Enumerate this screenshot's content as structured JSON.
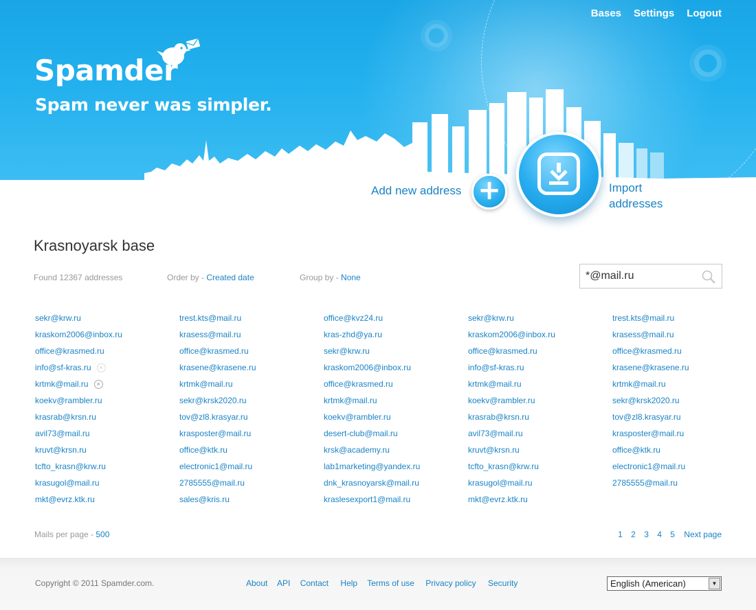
{
  "header": {
    "logo": "Spamder",
    "tagline": "Spam never was simpler.",
    "nav": [
      "Bases",
      "Settings",
      "Logout"
    ]
  },
  "actions": {
    "add_label": "Add new address",
    "add_symbol": "+",
    "import_line1": "Import",
    "import_line2": "addresses"
  },
  "base": {
    "title": "Krasnoyarsk base",
    "found": "Found 12367 addresses",
    "order_label": "Order by - ",
    "order_value": "Created date",
    "group_label": "Group by - ",
    "group_value": "None",
    "search_value": "*@mail.ru"
  },
  "email_columns": [
    [
      "sekr@krw.ru",
      "kraskom2006@inbox.ru",
      "office@krasmed.ru",
      "info@sf-kras.ru",
      "krtmk@mail.ru",
      "koekv@rambler.ru",
      "krasrab@krsn.ru",
      "avil73@mail.ru",
      "kruvt@krsn.ru",
      "tcfto_krasn@krw.ru",
      "krasugol@mail.ru",
      "mkt@evrz.ktk.ru"
    ],
    [
      "trest.kts@mail.ru",
      "krasess@mail.ru",
      "office@krasmed.ru",
      "krasene@krasene.ru",
      "krtmk@mail.ru",
      "sekr@krsk2020.ru",
      "tov@zl8.krasyar.ru",
      "krasposter@mail.ru",
      "office@ktk.ru",
      "electronic1@mail.ru",
      "2785555@mail.ru",
      "sales@kris.ru"
    ],
    [
      "office@kvz24.ru",
      "kras-zhd@ya.ru",
      "sekr@krw.ru",
      "kraskom2006@inbox.ru",
      "office@krasmed.ru",
      "krtmk@mail.ru",
      "koekv@rambler.ru",
      "desert-club@mail.ru",
      "krsk@academy.ru",
      "lab1marketing@yandex.ru",
      "dnk_krasnoyarsk@mail.ru",
      "kraslesexport1@mail.ru"
    ],
    [
      "sekr@krw.ru",
      "kraskom2006@inbox.ru",
      "office@krasmed.ru",
      "info@sf-kras.ru",
      "krtmk@mail.ru",
      "koekv@rambler.ru",
      "krasrab@krsn.ru",
      "avil73@mail.ru",
      "kruvt@krsn.ru",
      "tcfto_krasn@krw.ru",
      "krasugol@mail.ru",
      "mkt@evrz.ktk.ru"
    ],
    [
      "trest.kts@mail.ru",
      "krasess@mail.ru",
      "office@krasmed.ru",
      "krasene@krasene.ru",
      "krtmk@mail.ru",
      "sekr@krsk2020.ru",
      "tov@zl8.krasyar.ru",
      "krasposter@mail.ru",
      "office@ktk.ru",
      "electronic1@mail.ru",
      "2785555@mail.ru"
    ]
  ],
  "remove_symbol": "×",
  "pagination": {
    "per_page_label": "Mails per page - ",
    "per_page_value": "500",
    "pages": [
      "1",
      "2",
      "3",
      "4",
      "5"
    ],
    "next": "Next page"
  },
  "footer": {
    "copyright": "Copyright © 2011 Spamder.com.",
    "links": [
      "About",
      "API",
      "Contact",
      "Help",
      "Terms of use",
      "Privacy policy",
      "Security"
    ],
    "language": "English (American)",
    "lang_arrow": "▼"
  },
  "colors": {
    "accent": "#1a83c4",
    "header_blue": "#1aa6e6"
  },
  "icons": {
    "bird": "bird-icon",
    "search": "search-icon",
    "import": "download-icon",
    "remove": "remove-icon"
  }
}
